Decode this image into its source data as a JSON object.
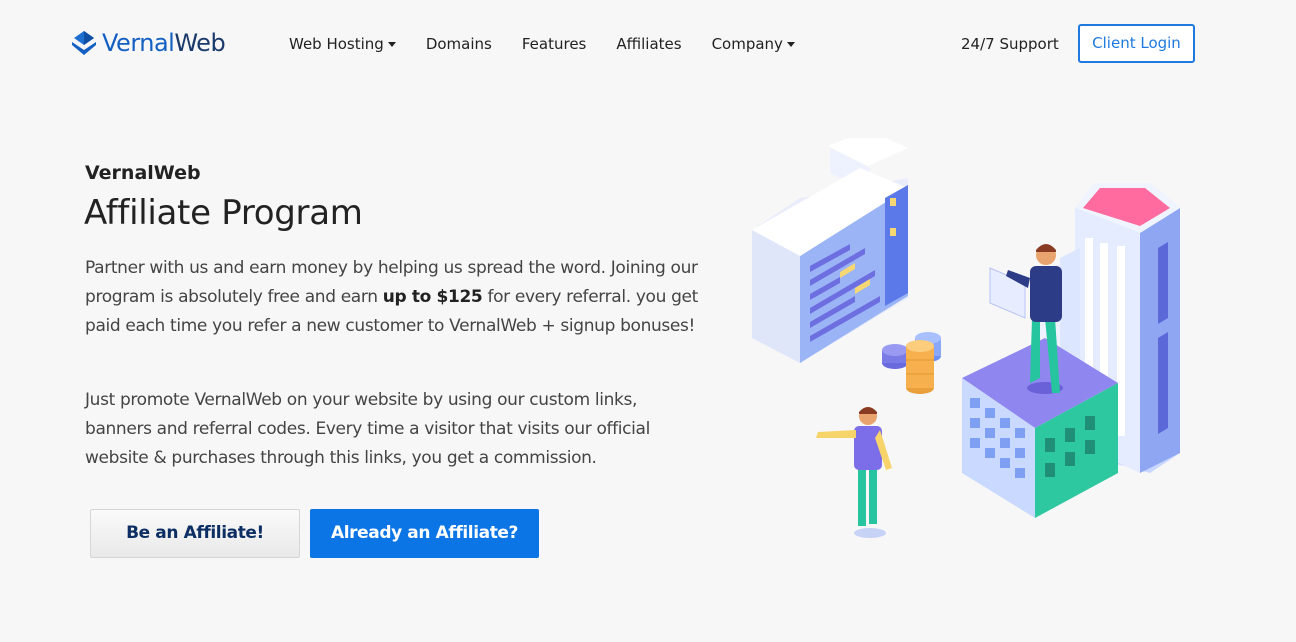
{
  "brand": {
    "logo_part1": "Vernal",
    "logo_part2": "Web"
  },
  "nav": {
    "items": [
      {
        "label": "Web Hosting",
        "dropdown": true
      },
      {
        "label": "Domains",
        "dropdown": false
      },
      {
        "label": "Features",
        "dropdown": false
      },
      {
        "label": "Affiliates",
        "dropdown": false
      },
      {
        "label": "Company",
        "dropdown": true
      }
    ],
    "support": "24/7 Support",
    "client_login": "Client Login"
  },
  "hero": {
    "subtitle": "VernalWeb",
    "title": "Affiliate Program",
    "para1_before": "Partner with us and earn money by helping us spread the word. Joining our program is absolutely free and earn ",
    "para1_bold": "up to $125",
    "para1_after": " for every referral. you get paid each time you refer a new customer to VernalWeb + signup bonuses!",
    "para2": "Just promote VernalWeb on your website by using our custom links, banners and referral codes. Every time a visitor that visits our official website & purchases through this links, you get a commission.",
    "btn_primary": "Be an Affiliate!",
    "btn_secondary": "Already an Affiliate?"
  },
  "colors": {
    "brand_blue": "#1360c2",
    "button_blue": "#0b75e6",
    "background": "#f7f7f7"
  },
  "icons": {
    "logo": "diamond-logo-icon",
    "dropdown": "caret-down-icon",
    "illustration": "isometric-buildings-illustration"
  }
}
